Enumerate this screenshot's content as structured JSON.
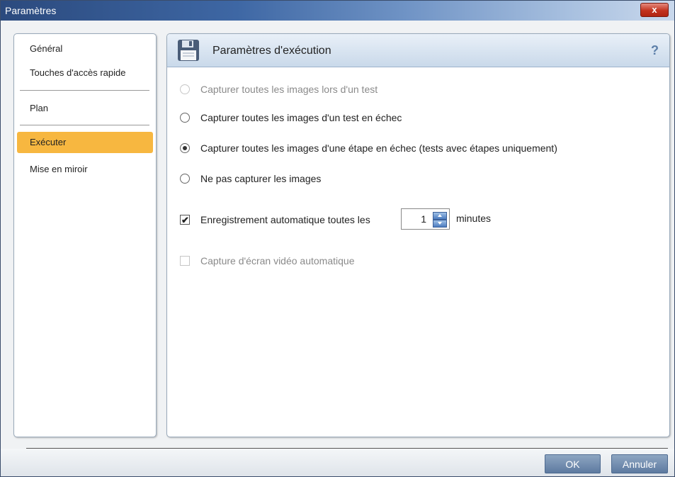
{
  "window": {
    "title": "Paramètres",
    "close_label": "x"
  },
  "sidebar": {
    "items": [
      {
        "label": "Général"
      },
      {
        "label": "Touches d'accès rapide"
      },
      {
        "label": "Plan"
      },
      {
        "label": "Exécuter",
        "active": true
      },
      {
        "label": "Mise en miroir"
      }
    ]
  },
  "panel": {
    "title": "Paramètres d'exécution",
    "help": "?",
    "options": {
      "capture_all_test": {
        "label": "Capturer toutes les images lors d'un test",
        "disabled": true,
        "checked": false
      },
      "capture_failed_test": {
        "label": "Capturer toutes les images d'un test en échec",
        "disabled": false,
        "checked": false
      },
      "capture_failed_step": {
        "label": "Capturer toutes les images d'une étape en échec (tests avec étapes uniquement)",
        "disabled": false,
        "checked": true
      },
      "no_capture": {
        "label": "Ne pas capturer les images",
        "disabled": false,
        "checked": false
      }
    },
    "autosave": {
      "label": "Enregistrement automatique toutes les",
      "value": "1",
      "unit": "minutes",
      "checked": true,
      "check_glyph": "✔"
    },
    "video": {
      "label": "Capture d'écran vidéo automatique",
      "checked": false,
      "disabled": true
    }
  },
  "footer": {
    "ok_label": "OK",
    "cancel_label": "Annuler"
  },
  "colors": {
    "active_nav": "#f7b740",
    "button": "#6f8bb0",
    "titlebar": "#3e67a4"
  }
}
